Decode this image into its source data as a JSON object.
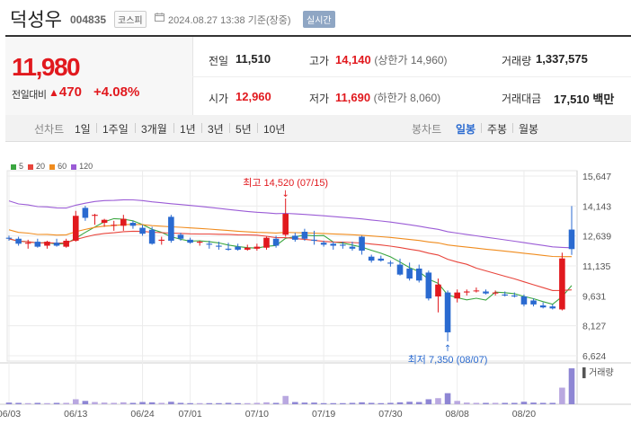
{
  "header": {
    "name": "덕성우",
    "code": "004835",
    "market": "코스피",
    "datetime": "2024.08.27 13:38",
    "session": "기준(장중)",
    "live_label": "실시간"
  },
  "quote": {
    "price": "11,980",
    "change_label": "전일대비",
    "change": "470",
    "change_pct": "+4.08%",
    "prev_label": "전일",
    "prev": "11,510",
    "open_label": "시가",
    "open": "12,960",
    "high_label": "고가",
    "high": "14,140",
    "upper_limit": "(상한가 14,960)",
    "low_label": "저가",
    "low": "11,690",
    "lower_limit": "(하한가 8,060)",
    "volume_label": "거래량",
    "volume": "1,337,575",
    "amount_label": "거래대금",
    "amount": "17,510 백만"
  },
  "tabs": {
    "line_label": "선차트",
    "line_periods": [
      "1일",
      "1주일",
      "3개월",
      "1년",
      "3년",
      "5년",
      "10년"
    ],
    "candle_label": "봉차트",
    "candle_periods": [
      "일봉",
      "주봉",
      "월봉"
    ],
    "active_candle": "일봉"
  },
  "colors": {
    "up": "#e1191e",
    "down": "#2a6ad0",
    "ma5": "#3aa640",
    "ma20": "#e8453c",
    "ma60": "#f08c1e",
    "ma120": "#9b5cd6"
  },
  "chart_data": {
    "type": "candlestick",
    "legend": [
      {
        "name": "5",
        "color": "#3aa640"
      },
      {
        "name": "20",
        "color": "#e8453c"
      },
      {
        "name": "60",
        "color": "#f08c1e"
      },
      {
        "name": "120",
        "color": "#9b5cd6"
      }
    ],
    "y_ticks": [
      "15,647",
      "14,143",
      "12,639",
      "11,135",
      "9,631",
      "8,127",
      "6,624"
    ],
    "ylim": [
      6624,
      15647
    ],
    "x_ticks": [
      "06/03",
      "06/13",
      "06/24",
      "07/01",
      "07/10",
      "07/19",
      "07/30",
      "08/08",
      "08/20"
    ],
    "high_note": "최고 14,520 (07/15)",
    "low_note": "최저 7,350 (08/07)",
    "volume_label": "거래량",
    "candles": [
      {
        "date": "06/03",
        "o": 12550,
        "h": 12650,
        "l": 12400,
        "c": 12500
      },
      {
        "date": "06/04",
        "o": 12500,
        "h": 12600,
        "l": 12150,
        "c": 12250
      },
      {
        "date": "06/05",
        "o": 12250,
        "h": 12450,
        "l": 12000,
        "c": 12300
      },
      {
        "date": "06/07",
        "o": 12350,
        "h": 12500,
        "l": 12050,
        "c": 12100
      },
      {
        "date": "06/10",
        "o": 12150,
        "h": 12400,
        "l": 12000,
        "c": 12350
      },
      {
        "date": "06/11",
        "o": 12300,
        "h": 12500,
        "l": 12100,
        "c": 12150
      },
      {
        "date": "06/12",
        "o": 12100,
        "h": 12500,
        "l": 12050,
        "c": 12400
      },
      {
        "date": "06/13",
        "o": 12400,
        "h": 13900,
        "l": 12350,
        "c": 13650
      },
      {
        "date": "06/14",
        "o": 14050,
        "h": 14150,
        "l": 13400,
        "c": 13550
      },
      {
        "date": "06/17",
        "o": 13650,
        "h": 13750,
        "l": 13200,
        "c": 13700
      },
      {
        "date": "06/18",
        "o": 13300,
        "h": 13500,
        "l": 13100,
        "c": 13450
      },
      {
        "date": "06/19",
        "o": 13200,
        "h": 13400,
        "l": 12900,
        "c": 13200
      },
      {
        "date": "06/20",
        "o": 13150,
        "h": 13700,
        "l": 12900,
        "c": 13500
      },
      {
        "date": "06/21",
        "o": 13300,
        "h": 13400,
        "l": 13000,
        "c": 13150
      },
      {
        "date": "06/24",
        "o": 13050,
        "h": 13200,
        "l": 12650,
        "c": 12750
      },
      {
        "date": "06/25",
        "o": 12950,
        "h": 13100,
        "l": 12200,
        "c": 12250
      },
      {
        "date": "06/26",
        "o": 12400,
        "h": 12600,
        "l": 12200,
        "c": 12450
      },
      {
        "date": "06/27",
        "o": 13600,
        "h": 13700,
        "l": 12300,
        "c": 12400
      },
      {
        "date": "06/28",
        "o": 12700,
        "h": 12800,
        "l": 12400,
        "c": 12500
      },
      {
        "date": "07/01",
        "o": 12450,
        "h": 12550,
        "l": 12250,
        "c": 12300
      },
      {
        "date": "07/02",
        "o": 12300,
        "h": 12400,
        "l": 12150,
        "c": 12350
      },
      {
        "date": "07/03",
        "o": 12250,
        "h": 12400,
        "l": 12000,
        "c": 12200
      },
      {
        "date": "07/04",
        "o": 12150,
        "h": 12350,
        "l": 11950,
        "c": 12100
      },
      {
        "date": "07/05",
        "o": 12000,
        "h": 12300,
        "l": 11900,
        "c": 11950
      },
      {
        "date": "07/08",
        "o": 12100,
        "h": 12250,
        "l": 11900,
        "c": 11950
      },
      {
        "date": "07/09",
        "o": 11950,
        "h": 12200,
        "l": 11900,
        "c": 12050
      },
      {
        "date": "07/10",
        "o": 12000,
        "h": 12250,
        "l": 11900,
        "c": 12100
      },
      {
        "date": "07/11",
        "o": 12050,
        "h": 12600,
        "l": 11950,
        "c": 12550
      },
      {
        "date": "07/12",
        "o": 12500,
        "h": 12650,
        "l": 12050,
        "c": 12150
      },
      {
        "date": "07/15",
        "o": 12700,
        "h": 14520,
        "l": 12600,
        "c": 13750
      },
      {
        "date": "07/16",
        "o": 12650,
        "h": 12800,
        "l": 12350,
        "c": 12450
      },
      {
        "date": "07/17",
        "o": 12850,
        "h": 13000,
        "l": 12400,
        "c": 12500
      },
      {
        "date": "07/18",
        "o": 12450,
        "h": 12900,
        "l": 12200,
        "c": 12400
      },
      {
        "date": "07/19",
        "o": 12300,
        "h": 12400,
        "l": 12100,
        "c": 12200
      },
      {
        "date": "07/22",
        "o": 12250,
        "h": 12350,
        "l": 11950,
        "c": 12150
      },
      {
        "date": "07/23",
        "o": 12200,
        "h": 12350,
        "l": 12000,
        "c": 12150
      },
      {
        "date": "07/24",
        "o": 12100,
        "h": 12350,
        "l": 11900,
        "c": 12000
      },
      {
        "date": "07/25",
        "o": 12600,
        "h": 12650,
        "l": 11700,
        "c": 11900
      },
      {
        "date": "07/26",
        "o": 11600,
        "h": 11700,
        "l": 11300,
        "c": 11400
      },
      {
        "date": "07/29",
        "o": 11500,
        "h": 11650,
        "l": 11350,
        "c": 11400
      },
      {
        "date": "07/30",
        "o": 11300,
        "h": 11400,
        "l": 11100,
        "c": 11250
      },
      {
        "date": "07/31",
        "o": 11200,
        "h": 11500,
        "l": 10650,
        "c": 10700
      },
      {
        "date": "08/01",
        "o": 11000,
        "h": 11300,
        "l": 10400,
        "c": 10500
      },
      {
        "date": "08/02",
        "o": 11000,
        "h": 11200,
        "l": 10300,
        "c": 10400
      },
      {
        "date": "08/05",
        "o": 10800,
        "h": 10900,
        "l": 9400,
        "c": 9500
      },
      {
        "date": "08/06",
        "o": 9600,
        "h": 10500,
        "l": 8800,
        "c": 10200
      },
      {
        "date": "08/07",
        "o": 9800,
        "h": 9900,
        "l": 7350,
        "c": 7800
      },
      {
        "date": "08/08",
        "o": 9500,
        "h": 9950,
        "l": 9300,
        "c": 9800
      },
      {
        "date": "08/09",
        "o": 9800,
        "h": 9950,
        "l": 9650,
        "c": 9850
      },
      {
        "date": "08/12",
        "o": 9900,
        "h": 10050,
        "l": 9800,
        "c": 9900
      },
      {
        "date": "08/13",
        "o": 9850,
        "h": 9950,
        "l": 9700,
        "c": 9750
      },
      {
        "date": "08/14",
        "o": 9750,
        "h": 9900,
        "l": 9650,
        "c": 9800
      },
      {
        "date": "08/16",
        "o": 9700,
        "h": 9850,
        "l": 9600,
        "c": 9650
      },
      {
        "date": "08/19",
        "o": 9650,
        "h": 9800,
        "l": 9550,
        "c": 9600
      },
      {
        "date": "08/20",
        "o": 9600,
        "h": 9700,
        "l": 9100,
        "c": 9200
      },
      {
        "date": "08/21",
        "o": 9400,
        "h": 9500,
        "l": 9100,
        "c": 9200
      },
      {
        "date": "08/22",
        "o": 9150,
        "h": 9300,
        "l": 9000,
        "c": 9050
      },
      {
        "date": "08/23",
        "o": 9100,
        "h": 9200,
        "l": 8950,
        "c": 9000
      },
      {
        "date": "08/26",
        "o": 8950,
        "h": 11800,
        "l": 8900,
        "c": 11510
      },
      {
        "date": "08/27",
        "o": 12960,
        "h": 14140,
        "l": 11690,
        "c": 11980
      }
    ],
    "volumes": [
      6,
      5,
      4,
      5,
      4,
      5,
      5,
      18,
      12,
      8,
      6,
      5,
      7,
      5,
      8,
      7,
      5,
      9,
      5,
      4,
      4,
      4,
      4,
      5,
      4,
      4,
      5,
      7,
      5,
      30,
      8,
      6,
      6,
      4,
      4,
      4,
      5,
      7,
      5,
      4,
      5,
      7,
      9,
      8,
      18,
      22,
      40,
      12,
      6,
      5,
      5,
      5,
      5,
      5,
      9,
      6,
      5,
      5,
      60,
      130
    ]
  }
}
